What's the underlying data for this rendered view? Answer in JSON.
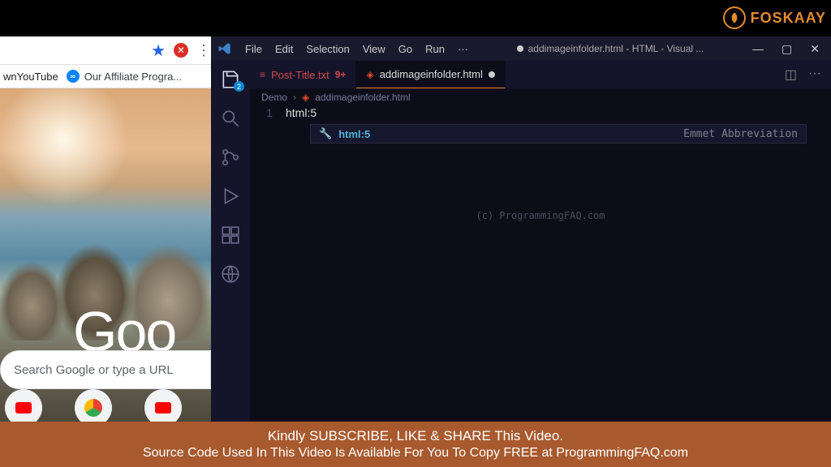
{
  "brand": {
    "text": "FOSKAAY"
  },
  "chrome": {
    "bookmark1": "wnYouTube",
    "bookmark2": "Our Affiliate Progra...",
    "logo_text": "Goo",
    "search_placeholder": "Search Google or type a URL"
  },
  "vscode": {
    "menu": {
      "file": "File",
      "edit": "Edit",
      "selection": "Selection",
      "view": "View",
      "go": "Go",
      "run": "Run",
      "more": "···"
    },
    "window_title": "addimageinfolder.html - HTML - Visual ...",
    "tabs": {
      "tab1": "Post-Title.txt",
      "tab1_badge": "9+",
      "tab2": "addimageinfolder.html"
    },
    "breadcrumb": {
      "root": "Demo",
      "file": "addimageinfolder.html"
    },
    "code": {
      "line1": "html:5"
    },
    "suggest": {
      "label": "html:5",
      "hint": "Emmet Abbreviation"
    },
    "watermark": "(c) ProgrammingFAQ.com",
    "activity_badge": "2"
  },
  "banner": {
    "line1": "Kindly SUBSCRIBE, LIKE & SHARE This Video.",
    "line2": "Source Code Used In This Video Is Available For You To Copy  FREE at  ProgrammingFAQ.com"
  }
}
